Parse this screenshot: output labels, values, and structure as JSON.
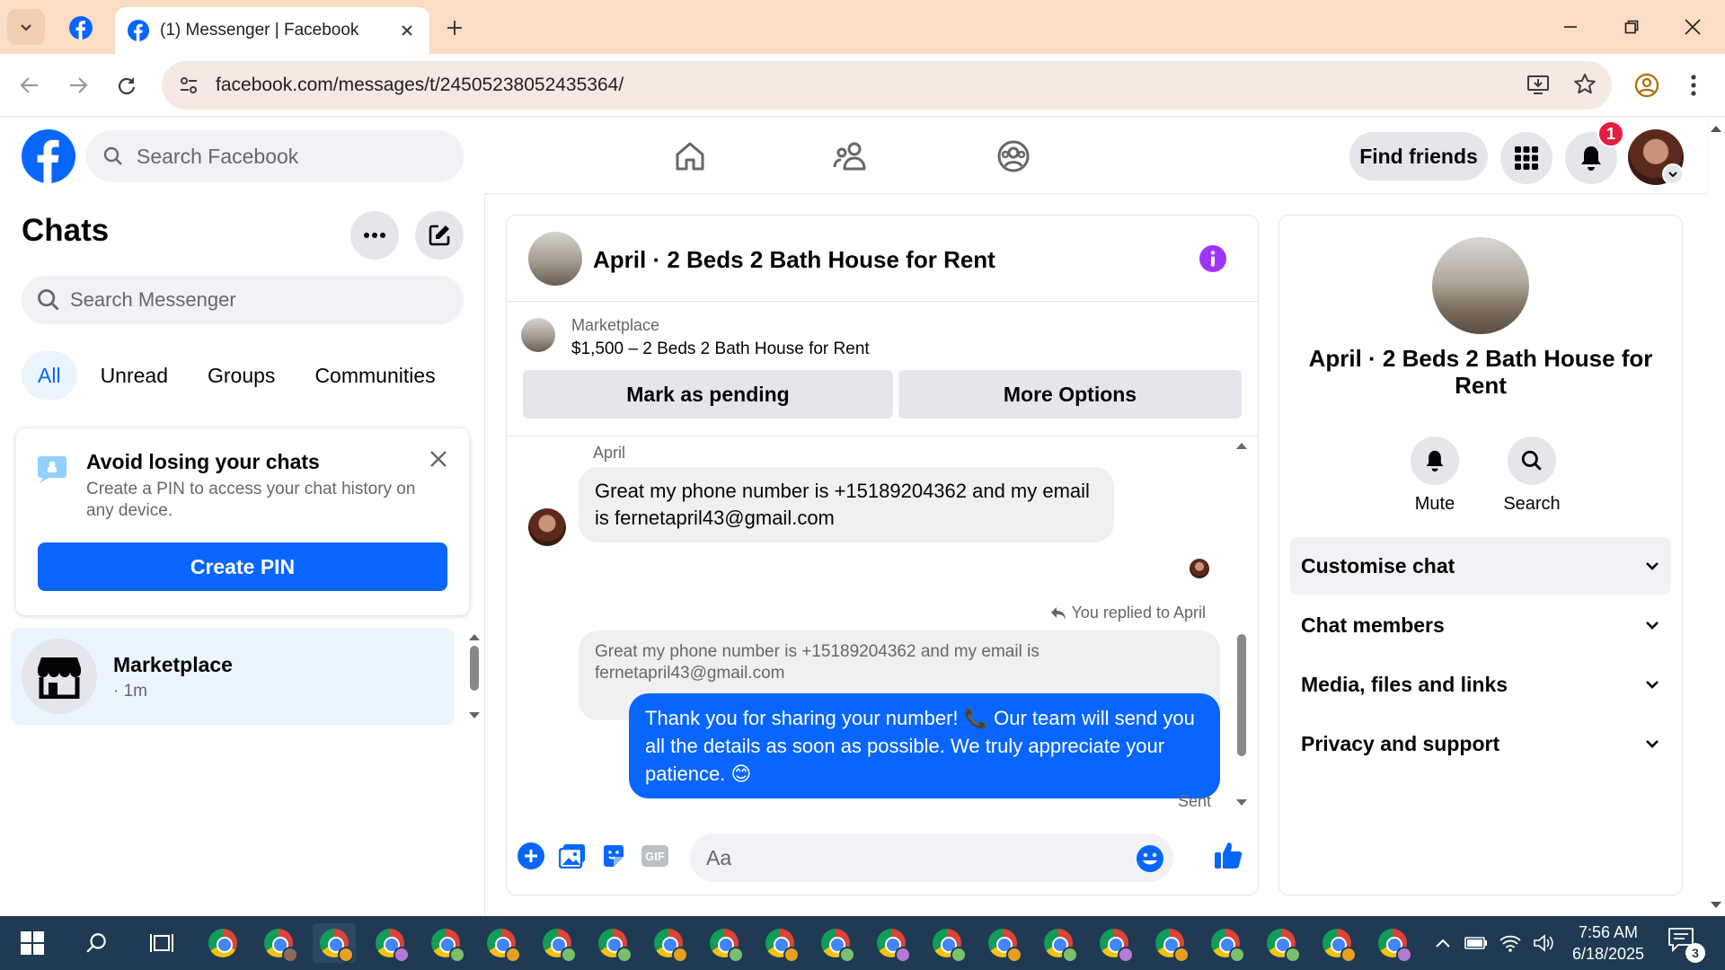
{
  "browser": {
    "tab_title": "(1) Messenger | Facebook",
    "url": "facebook.com/messages/t/24505238052435364/",
    "accent_color": "#fbdcc4"
  },
  "header": {
    "search_placeholder": "Search Facebook",
    "find_friends_label": "Find friends",
    "notification_count": "1",
    "brand_color": "#0866ff"
  },
  "chats": {
    "title": "Chats",
    "search_placeholder": "Search Messenger",
    "filters": [
      "All",
      "Unread",
      "Groups",
      "Communities"
    ],
    "active_filter": "All",
    "pin_card": {
      "title": "Avoid losing your chats",
      "description": "Create a PIN to access your chat history on any device.",
      "button_label": "Create PIN"
    },
    "items": [
      {
        "name": "Marketplace",
        "time": "· 1m"
      }
    ]
  },
  "conversation": {
    "title": "April · 2 Beds 2 Bath House for Rent",
    "marketplace_label": "Marketplace",
    "listing": "$1,500 – 2 Beds 2 Bath House for Rent",
    "mark_pending_label": "Mark as pending",
    "more_options_label": "More Options",
    "messages": {
      "sender_name": "April",
      "incoming_text": "Great my phone number is +15189204362 and my email is fernetapril43@gmail.com",
      "reply_label": "You replied to April",
      "quoted_text": "Great my phone number is +15189204362 and my email is fernetapril43@gmail.com",
      "outgoing_text": "Thank you for sharing your number! 📞 Our team will send you all the details as soon as possible. We truly appreciate your patience. 😊",
      "status": "Sent"
    },
    "composer_placeholder": "Aa"
  },
  "details": {
    "title": "April · 2 Beds 2 Bath House for Rent",
    "actions": [
      "Mute",
      "Search"
    ],
    "sections": [
      "Customise chat",
      "Chat members",
      "Media, files and links",
      "Privacy and support"
    ]
  },
  "taskbar": {
    "time": "7:56 AM",
    "date": "6/18/2025",
    "notification_count": "3"
  }
}
